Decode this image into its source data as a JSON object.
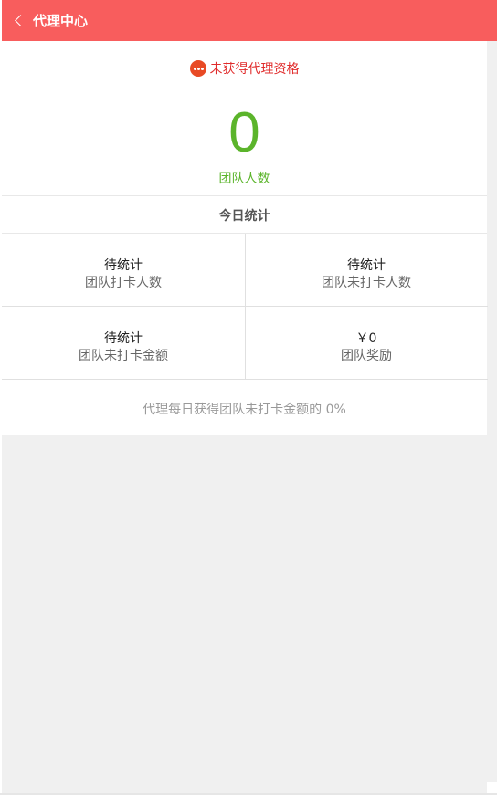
{
  "header": {
    "title": "代理中心"
  },
  "status": {
    "text": "未获得代理资格",
    "icon": "more-dots-icon"
  },
  "team": {
    "count": "0",
    "label": "团队人数"
  },
  "stats": {
    "title": "今日统计",
    "cells": [
      {
        "value": "待统计",
        "label": "团队打卡人数"
      },
      {
        "value": "待统计",
        "label": "团队未打卡人数"
      },
      {
        "value": "待统计",
        "label": "团队未打卡金额"
      },
      {
        "value": "￥0",
        "label": "团队奖励"
      }
    ]
  },
  "note": "代理每日获得团队未打卡金额的 0%",
  "colors": {
    "header": "#f85d5d",
    "accent_green": "#5bb42b",
    "status_red": "#e02b2b",
    "icon_orange": "#e84a25"
  }
}
